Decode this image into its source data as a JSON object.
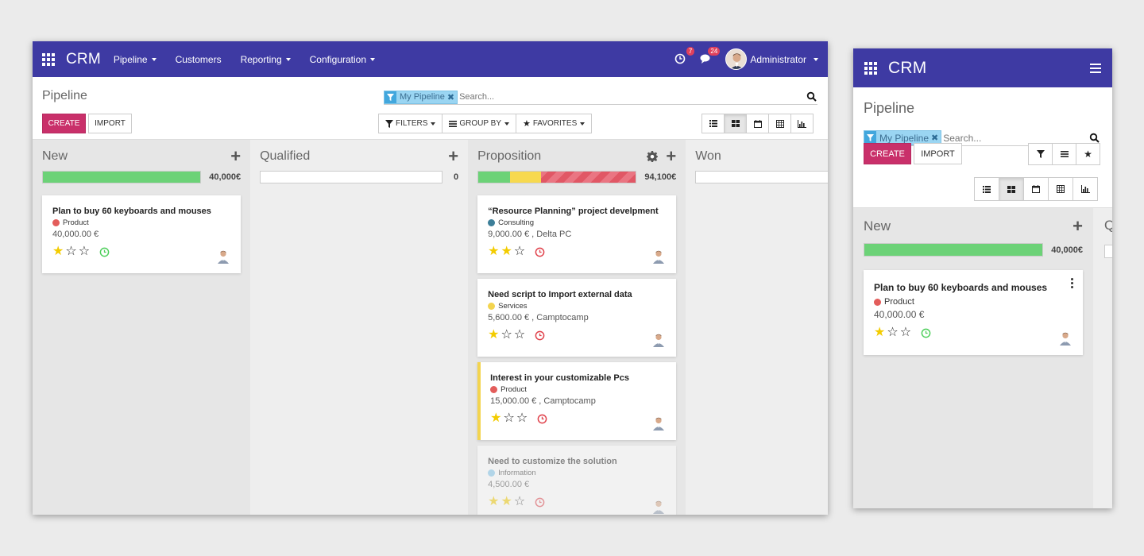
{
  "app": {
    "name": "CRM"
  },
  "nav": {
    "menus": [
      "Pipeline",
      "Customers",
      "Reporting",
      "Configuration"
    ],
    "activities_count": "7",
    "messages_count": "24",
    "user": "Administrator"
  },
  "control": {
    "title": "Pipeline",
    "facet": "My Pipeline",
    "search_placeholder": "Search...",
    "create_label": "CREATE",
    "import_label": "IMPORT",
    "filters_label": "FILTERS",
    "groupby_label": "GROUP BY",
    "favorites_label": "FAVORITES"
  },
  "columns": [
    {
      "name": "New",
      "sum": "40,000€"
    },
    {
      "name": "Qualified",
      "sum": "0"
    },
    {
      "name": "Proposition",
      "sum": "94,100€"
    },
    {
      "name": "Won",
      "sum": ""
    }
  ],
  "cards": [
    {
      "title": "Plan to buy 60 keyboards and mouses",
      "tag": "Product",
      "tag_color": "#e35d5b",
      "amount": "40,000.00 €",
      "stars": 1,
      "clock_color": "#4fcf5c"
    },
    {
      "title": "“Resource Planning” project develpment",
      "tag": "Consulting",
      "tag_color": "#3d7f99",
      "amount": "9,000.00 € , Delta PC",
      "stars": 2,
      "clock_color": "#e0404a"
    },
    {
      "title": "Need script to Import external data",
      "tag": "Services",
      "tag_color": "#f3d44f",
      "amount": "5,600.00 € , Camptocamp",
      "stars": 1,
      "clock_color": "#e0404a"
    },
    {
      "title": "Interest in your customizable Pcs",
      "tag": "Product",
      "tag_color": "#e35d5b",
      "amount": "15,000.00 € , Camptocamp",
      "stars": 1,
      "clock_color": "#e0404a"
    },
    {
      "title": "Need to customize the solution",
      "tag": "Information",
      "tag_color": "#7fc5ea",
      "amount": "4,500.00 €",
      "stars": 2,
      "clock_color": "#e0404a"
    }
  ],
  "progress": {
    "new": [
      {
        "color": "green",
        "fraction": 1.0
      }
    ],
    "proposition": [
      {
        "color": "green",
        "fraction": 0.2
      },
      {
        "color": "yellow",
        "fraction": 0.2
      },
      {
        "color": "red",
        "fraction": 0.6
      }
    ]
  },
  "mobile_peek_letter": "Q"
}
